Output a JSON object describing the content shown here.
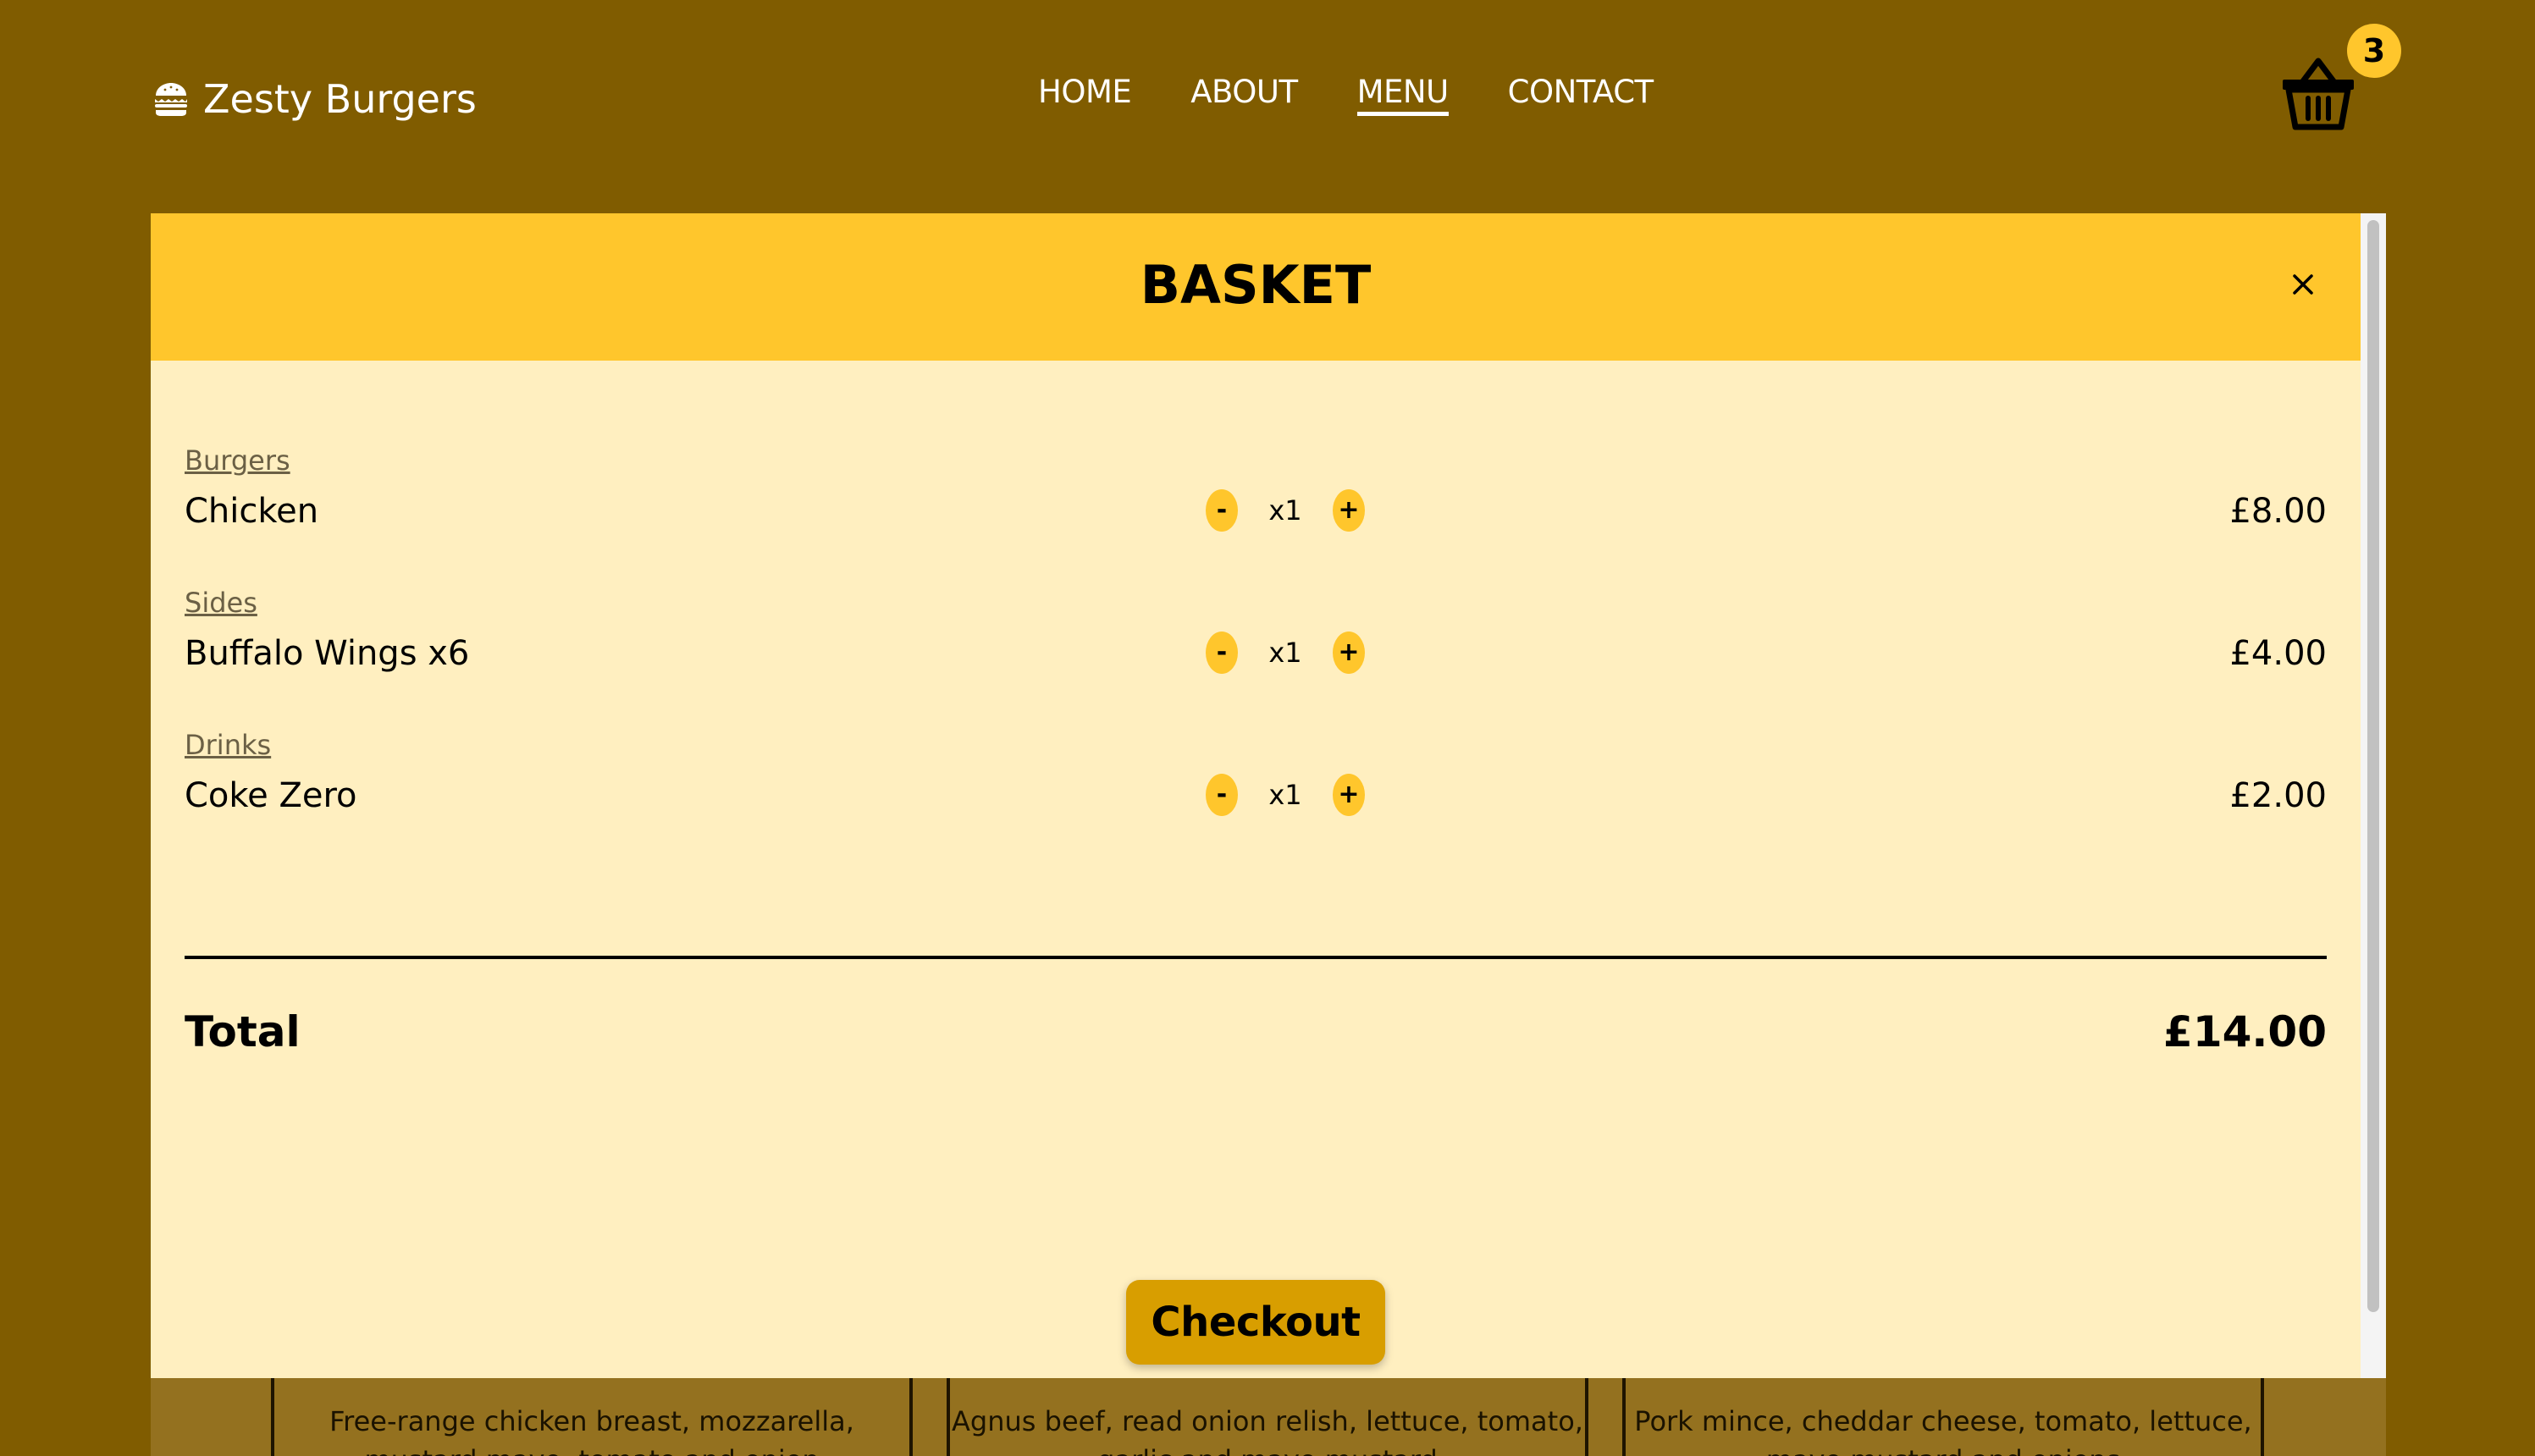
{
  "navbar": {
    "brand": "Zesty Burgers",
    "brand_icon": "burger-icon",
    "links": [
      {
        "label": "HOME",
        "active": false
      },
      {
        "label": "ABOUT",
        "active": false
      },
      {
        "label": "MENU",
        "active": true
      },
      {
        "label": "CONTACT",
        "active": false
      }
    ],
    "cart_icon": "basket-icon",
    "cart_count": "3"
  },
  "basket": {
    "title": "BASKET",
    "close_icon": "close-icon",
    "items": [
      {
        "category": "Burgers",
        "name": "Chicken",
        "decrease": "-",
        "quantity": "x1",
        "increase": "+",
        "price": "£8.00"
      },
      {
        "category": "Sides",
        "name": "Buffalo Wings x6",
        "decrease": "-",
        "quantity": "x1",
        "increase": "+",
        "price": "£4.00"
      },
      {
        "category": "Drinks",
        "name": "Coke Zero",
        "decrease": "-",
        "quantity": "x1",
        "increase": "+",
        "price": "£2.00"
      }
    ],
    "total_label": "Total",
    "total_value": "£14.00",
    "checkout_label": "Checkout"
  },
  "background_menu": {
    "cards": [
      {
        "description": "Free-range chicken breast, mozzarella, mustard mayo, tomato and onion"
      },
      {
        "description": "Agnus beef, read onion relish, lettuce, tomato, garlic and mayo mustard"
      },
      {
        "description": "Pork mince, cheddar cheese, tomato, lettuce, mayo mustard and onions"
      }
    ]
  },
  "colors": {
    "backdrop": "#805c00",
    "accent": "#ffc62c",
    "modal_body": "#ffefc0",
    "checkout": "#d89e00"
  }
}
